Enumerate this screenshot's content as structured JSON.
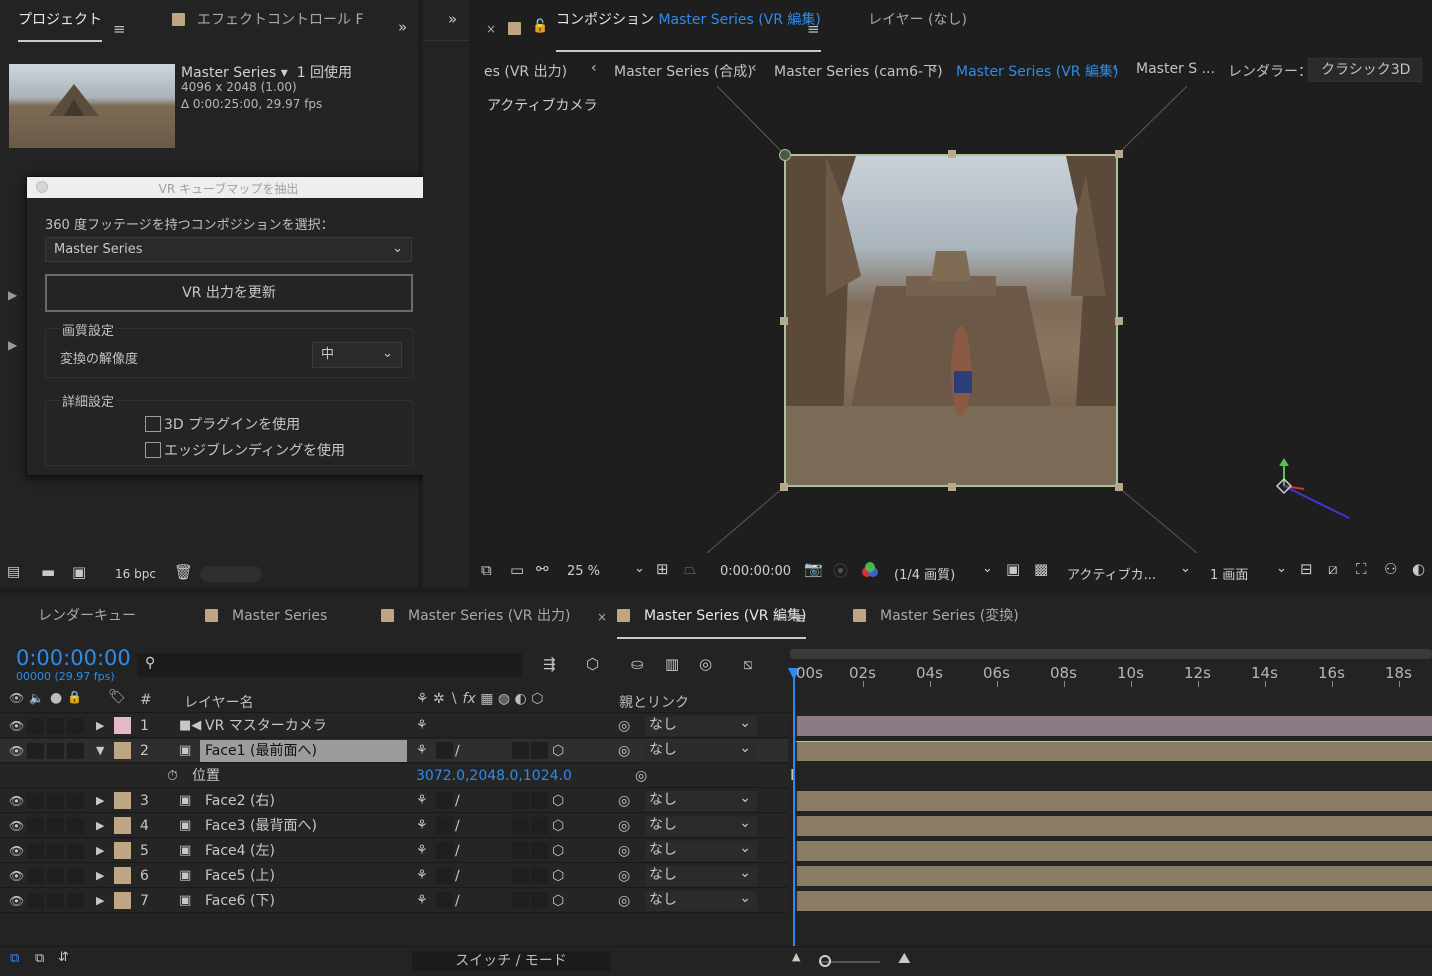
{
  "project_panel": {
    "tab_project": "プロジェクト",
    "tab_effect": "エフェクトコントロール F",
    "item_name": "Master Series ▾",
    "item_usage": "1 回使用",
    "item_dims": "4096 x 2048 (1.00)",
    "item_duration": "∆ 0:00:25:00, 29.97 fps",
    "bpc": "16 bpc"
  },
  "dialog": {
    "title": "VR キューブマップを抽出",
    "prompt": "360 度フッテージを持つコンポジションを選択：",
    "comp_select": "Master Series",
    "update_button": "VR 出力を更新",
    "quality_group": "画質設定",
    "conversion_label": "変換の解像度",
    "conversion_value": "中",
    "advanced_group": "詳細設定",
    "check_3d": "3D プラグインを使用",
    "check_edge": "エッジブレンディングを使用"
  },
  "composition": {
    "tab_prefix": "コンポジション",
    "tab_name": "Master Series (VR 編集)",
    "tab_layer": "レイヤー (なし)",
    "breadcrumbs": [
      "es (VR 出力)",
      "Master Series (合成)",
      "Master Series (cam6-下)",
      "Master Series (VR 編集)",
      "Master S ..."
    ],
    "renderer_label": "レンダラー：",
    "renderer_value": "クラシック3D",
    "active_camera": "アクティブカメラ",
    "zoom": "25 %",
    "timecode": "0:00:00:00",
    "resolution": "(1/4 画質)",
    "view": "アクティブカ...",
    "views": "1 画面"
  },
  "timeline": {
    "tabs": [
      "レンダーキュー",
      "Master Series",
      "Master Series (VR 出力)",
      "Master Series (VR 編集)",
      "Master Series (変換)"
    ],
    "timecode": "0:00:00:00",
    "fps": "00000 (29.97 fps)",
    "col_layer": "レイヤー名",
    "col_parent": "親とリンク",
    "col_hash": "#",
    "switch_mode": "スイッチ / モード",
    "ruler": [
      "00s",
      "02s",
      "04s",
      "06s",
      "08s",
      "10s",
      "12s",
      "14s",
      "16s",
      "18s"
    ],
    "layers": [
      {
        "num": "1",
        "name": "VR マスターカメラ",
        "parent": "なし",
        "color": "#e6b7c8"
      },
      {
        "num": "2",
        "name": "Face1 (最前面へ)",
        "parent": "なし",
        "color": "#bfa683"
      },
      {
        "num": "3",
        "name": "Face2 (右)",
        "parent": "なし",
        "color": "#bfa683"
      },
      {
        "num": "4",
        "name": "Face3 (最背面へ)",
        "parent": "なし",
        "color": "#bfa683"
      },
      {
        "num": "5",
        "name": "Face4 (左)",
        "parent": "なし",
        "color": "#bfa683"
      },
      {
        "num": "6",
        "name": "Face5 (上)",
        "parent": "なし",
        "color": "#bfa683"
      },
      {
        "num": "7",
        "name": "Face6 (下)",
        "parent": "なし",
        "color": "#bfa683"
      }
    ],
    "position_label": "位置",
    "position_value": "3072.0,2048.0,1024.0"
  },
  "colors": {
    "accent": "#2d8ceb",
    "camera_bar": "#8c7a86",
    "footage_bar": "#8a7b64"
  }
}
